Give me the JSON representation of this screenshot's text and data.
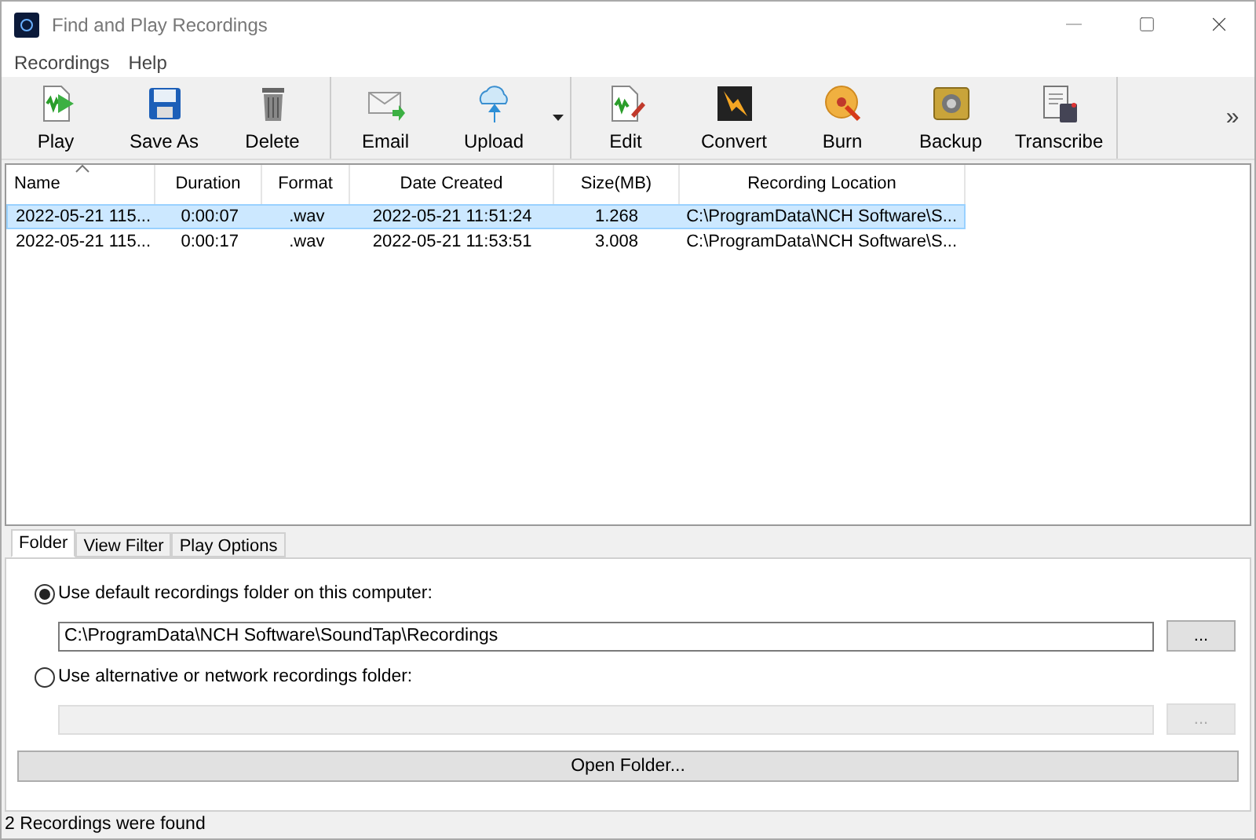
{
  "window": {
    "title": "Find and Play Recordings"
  },
  "menu": [
    "Recordings",
    "Help"
  ],
  "toolbar": {
    "groups": [
      [
        {
          "kind": "button",
          "label": "Play"
        },
        {
          "kind": "button",
          "label": "Save As"
        },
        {
          "kind": "button",
          "label": "Delete"
        }
      ],
      [
        {
          "kind": "button",
          "label": "Email"
        },
        {
          "kind": "button",
          "label": "Upload"
        },
        {
          "kind": "dropdown"
        }
      ],
      [
        {
          "kind": "button",
          "label": "Edit"
        },
        {
          "kind": "button",
          "label": "Convert"
        },
        {
          "kind": "button",
          "label": "Burn"
        },
        {
          "kind": "button",
          "label": "Backup"
        },
        {
          "kind": "button",
          "label": "Transcribe"
        }
      ]
    ],
    "overflow": "»"
  },
  "table": {
    "columns": [
      {
        "label": "Name",
        "sorted": true
      },
      {
        "label": "Duration",
        "sorted": false
      },
      {
        "label": "Format",
        "sorted": false
      },
      {
        "label": "Date Created",
        "sorted": false
      },
      {
        "label": "Size(MB)",
        "sorted": false
      },
      {
        "label": "Recording Location",
        "sorted": false
      }
    ],
    "rows": [
      {
        "selected": true,
        "cells": [
          "2022-05-21 115...",
          "0:00:07",
          ".wav",
          "2022-05-21 11:51:24",
          "1.268",
          "C:\\ProgramData\\NCH Software\\S..."
        ]
      },
      {
        "selected": false,
        "cells": [
          "2022-05-21 115...",
          "0:00:17",
          ".wav",
          "2022-05-21 11:53:51",
          "3.008",
          "C:\\ProgramData\\NCH Software\\S..."
        ]
      }
    ]
  },
  "tabs": [
    {
      "label": "Folder",
      "selected": true
    },
    {
      "label": "View Filter",
      "selected": false
    },
    {
      "label": "Play Options",
      "selected": false
    }
  ],
  "folder_options": [
    {
      "label": "Use default recordings folder on this computer:",
      "selected": true,
      "field": {
        "value": "C:\\ProgramData\\NCH Software\\SoundTap\\Recordings",
        "disabled": false
      },
      "browse": {
        "label": "...",
        "disabled": false
      }
    },
    {
      "label": "Use alternative or network recordings folder:",
      "selected": false,
      "field": {
        "disabled": true
      },
      "browse": {
        "label": "...",
        "disabled": true
      }
    }
  ],
  "open_folder_button": "Open Folder...",
  "status_bar": "2 Recordings were found"
}
